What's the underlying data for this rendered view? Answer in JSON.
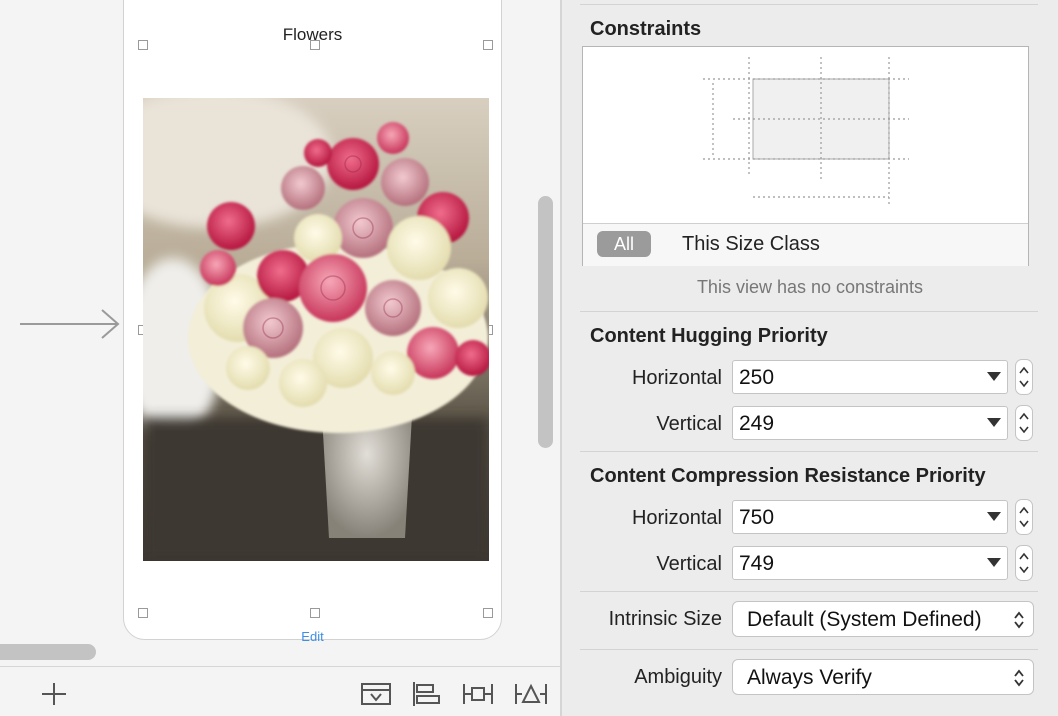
{
  "canvas": {
    "scene_title": "Flowers",
    "toolbar_link": "Edit",
    "bottom_toolbar": {
      "items": [
        {
          "icon": "add-icon"
        },
        {
          "icon": "embed-in-stack-icon"
        },
        {
          "icon": "align-icon"
        },
        {
          "icon": "pin-icon"
        },
        {
          "icon": "resolve-auto-layout-icon"
        }
      ]
    }
  },
  "inspector": {
    "constraints": {
      "title": "Constraints",
      "tab_all": "All",
      "tab_size_class": "This Size Class",
      "empty_message": "This view has no constraints"
    },
    "hugging": {
      "title": "Content Hugging Priority",
      "horizontal_label": "Horizontal",
      "horizontal_value": "250",
      "vertical_label": "Vertical",
      "vertical_value": "249"
    },
    "compression": {
      "title": "Content Compression Resistance Priority",
      "horizontal_label": "Horizontal",
      "horizontal_value": "750",
      "vertical_label": "Vertical",
      "vertical_value": "749"
    },
    "intrinsic_size": {
      "label": "Intrinsic Size",
      "value": "Default (System Defined)"
    },
    "ambiguity": {
      "label": "Ambiguity",
      "value": "Always Verify"
    }
  },
  "colors": {
    "link_blue": "#3c8ee6",
    "tab_selected_bg": "#9b9b9b",
    "panel_bg": "#ececec"
  }
}
